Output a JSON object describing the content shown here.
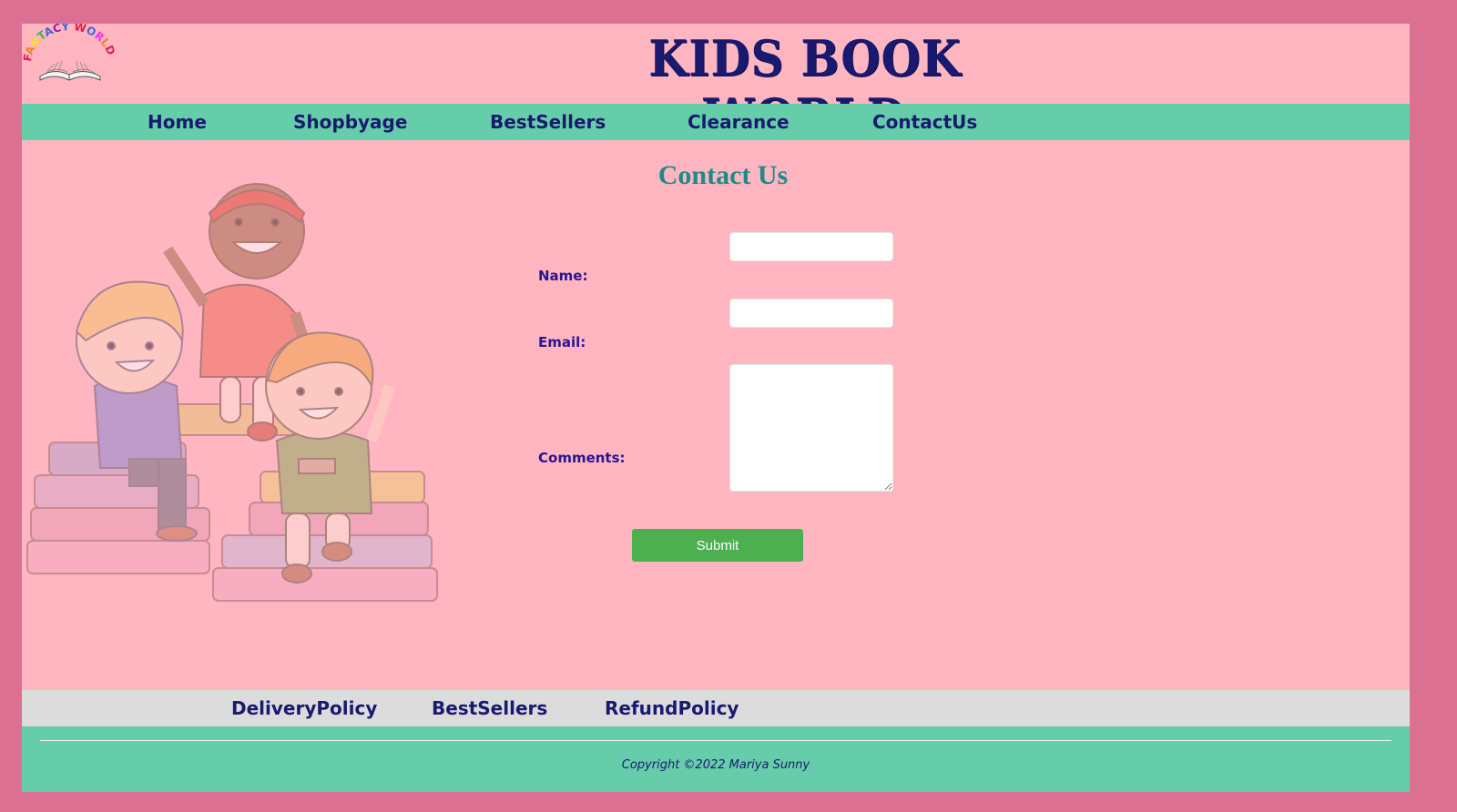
{
  "header": {
    "logo_text": "FANTACY WORLD",
    "title": "KIDS BOOK WORLD"
  },
  "nav": {
    "items": [
      "Home",
      "Shopbyage",
      "BestSellers",
      "Clearance",
      "ContactUs"
    ]
  },
  "contact": {
    "title": "Contact Us",
    "name_label": "Name:",
    "name_value": "",
    "email_label": "Email:",
    "email_value": "",
    "comments_label": "Comments:",
    "comments_value": "",
    "submit_label": "Submit"
  },
  "footer_nav": {
    "items": [
      "DeliveryPolicy",
      "BestSellers",
      "RefundPolicy"
    ]
  },
  "footer": {
    "copyright": "Copyright ©2022 Mariya Sunny"
  },
  "colors": {
    "outer_bg": "#db7093",
    "page_bg": "#ffb6c1",
    "nav_bg": "#66cdaa",
    "footer_nav_bg": "#dcdcdc",
    "title_color": "#191970",
    "contact_title_color": "#20898a",
    "submit_bg": "#4caf50"
  },
  "icons": {
    "logo": "open-book-logo-icon",
    "illustration": "kids-sitting-on-books-illustration"
  }
}
